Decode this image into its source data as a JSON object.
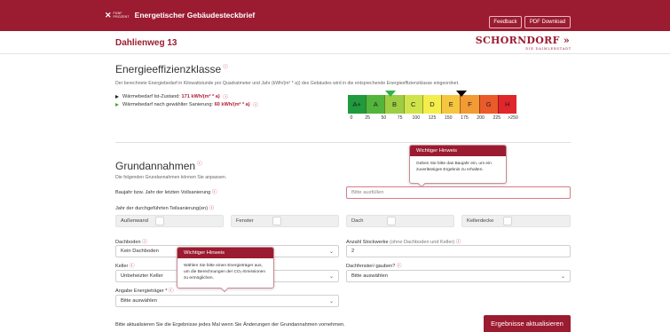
{
  "header": {
    "logo_line1": "FÜNF",
    "logo_line2": "PROZENT",
    "title": "Energetischer Gebäudesteckbrief",
    "feedback_label": "Feedback",
    "pdf_label": "PDF Download",
    "bg_color": "#9b1b30"
  },
  "subheader": {
    "street": "Dahlienweg 13",
    "city": "SCHORNDORF »",
    "city_sub": "DIE DAIMLERSTADT"
  },
  "efficiency": {
    "title": "Energieeffizienzklasse",
    "info_mark": "ⓘ",
    "description": "Der berechnete Energiebedarf in Kilowattstunde pro Quadratmeter und Jahr (kWh/(m² * a)) des Gebäudes wird in die entsprechende Energieeffizienzklasse eingeordnet.",
    "current_label": "Wärmebedarf Ist-Zustand:",
    "current_value": "171 kWh/(m² * a)",
    "renovated_label": "Wärmebedarf nach gewählter Sanierung:",
    "renovated_value": "60 kWh/(m² * a)",
    "classes": [
      {
        "label": "A+",
        "color": "#1f9a3c"
      },
      {
        "label": "A",
        "color": "#53b43b"
      },
      {
        "label": "B",
        "color": "#9ccd43"
      },
      {
        "label": "C",
        "color": "#cfe44a"
      },
      {
        "label": "D",
        "color": "#f3ee4b"
      },
      {
        "label": "E",
        "color": "#f6c640"
      },
      {
        "label": "F",
        "color": "#f29a34"
      },
      {
        "label": "G",
        "color": "#eb5b2a"
      },
      {
        "label": "H",
        "color": "#e0252b"
      }
    ],
    "ticks": [
      "0",
      "25",
      "50",
      "75",
      "100",
      "125",
      "150",
      "175",
      "200",
      "225",
      ">250"
    ],
    "current_kwh": 171,
    "renovated_kwh": 60
  },
  "assumptions": {
    "title": "Grundannahmen",
    "info_mark": "ⓘ",
    "description": "Die folgenden Grundannahmen können Sie anpassen.",
    "baujahr_label": "Baujahr bzw. Jahr der letzten Vollsanierung",
    "baujahr_placeholder": "Bitte ausfüllen",
    "teilsanierung_label": "Jahr der durchgeführten Teilsanierung(en)",
    "toggles": [
      "Außenwand",
      "Fenster",
      "Dach",
      "Kellerdecke"
    ],
    "dachboden_label": "Dachboden",
    "dachboden_value": "Kein Dachboden",
    "stockwerke_label": "Anzahl Stockwerke",
    "stockwerke_hint": "(ohne Dachboden und Keller)",
    "stockwerke_value": "2",
    "keller_label": "Keller",
    "keller_value": "Unbeheizter Keller",
    "gauben_label": "Dachfenster/-gauben?",
    "gauben_value": "Bitte auswählen",
    "energietraeger_label": "Angabe Energieträger *",
    "energietraeger_value": "Bitte auswählen"
  },
  "tooltips": {
    "baujahr_title": "Wichtiger Hinweis",
    "baujahr_body": "Geben Sie bitte das Baujahr ein, um ein zuverlässiges Ergebnis zu erhalten.",
    "energie_title": "Wichtiger Hinweis",
    "energie_body": "Wählen Sie bitte einen Energieträger aus, um die Berechnungen der CO₂-Emissionen zu ermöglichen."
  },
  "footer": {
    "note": "Bitte aktualisieren Sie die Ergebnisse jedes Mal wenn Sie Änderungen der Grundannahmen vornehmen.",
    "update_label": "Ergebnisse aktualisieren"
  }
}
